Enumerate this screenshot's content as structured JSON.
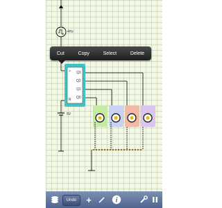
{
  "clock": {
    "freq_label": "4Hz"
  },
  "battery": {
    "voltage_label": "5V"
  },
  "context_menu": {
    "items": [
      "Cut",
      "Copy",
      "Select",
      "Delete"
    ]
  },
  "chip": {
    "pins_left": [
      ">",
      "R"
    ],
    "pins_right": [
      "Q3",
      "Q2",
      "Q1",
      "Q0"
    ]
  },
  "leds": [
    {
      "color": "#c6e9a6",
      "name": "led-green"
    },
    {
      "color": "#c8d3f4",
      "name": "led-blue"
    },
    {
      "color": "#f2b9a8",
      "name": "led-red"
    },
    {
      "color": "#d9c5ee",
      "name": "led-purple"
    }
  ],
  "toolbar": {
    "undo_label": "Undo",
    "add_label": "+"
  },
  "icons": [
    "layers-icon",
    "plus-icon",
    "pencil-icon",
    "info-icon",
    "wrench-icon",
    "pause-icon"
  ]
}
